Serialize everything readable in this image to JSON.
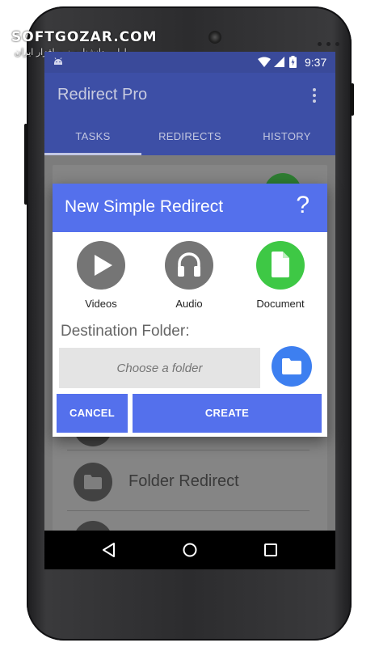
{
  "watermark": {
    "text": "SOFTGOZAR.COM",
    "subtext": "اولین دانشنامه نرم افزار ایران"
  },
  "status_bar": {
    "time": "9:37",
    "icons": [
      "android-icon",
      "wifi-icon",
      "signal-icon",
      "battery-charging-icon"
    ]
  },
  "app_bar": {
    "title": "Redirect Pro",
    "overflow_icon": "more-vert-icon"
  },
  "tabs": [
    {
      "label": "TASKS",
      "selected": true
    },
    {
      "label": "REDIRECTS",
      "selected": false
    },
    {
      "label": "HISTORY",
      "selected": false
    }
  ],
  "background_list": {
    "rows": [
      {
        "label": ""
      },
      {
        "label": "Folder Redirect",
        "icon": "folder-icon"
      },
      {
        "label": ""
      }
    ]
  },
  "dialog": {
    "title": "New Simple Redirect",
    "help_label": "?",
    "options": [
      {
        "label": "Videos",
        "icon": "play-icon",
        "selected": false
      },
      {
        "label": "Audio",
        "icon": "headphones-icon",
        "selected": false
      },
      {
        "label": "Document",
        "icon": "document-icon",
        "selected": true
      }
    ],
    "destination_label": "Destination Folder:",
    "folder_placeholder": "Choose a folder",
    "folder_button_icon": "folder-icon",
    "cancel_label": "CANCEL",
    "create_label": "CREATE"
  },
  "navigation": {
    "icons": [
      "back-icon",
      "home-icon",
      "recents-icon"
    ]
  },
  "colors": {
    "primary": "#3d4fa6",
    "status_bar": "#3a4a9a",
    "dialog_accent": "#5470ec",
    "selected_option": "#3ec845",
    "folder_button": "#3d7ff0"
  }
}
